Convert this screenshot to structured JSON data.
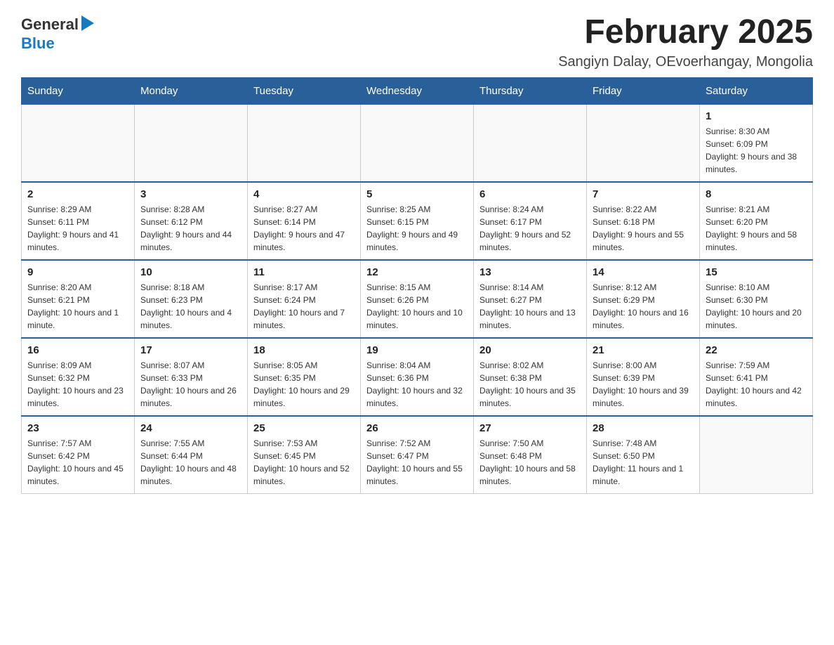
{
  "header": {
    "logo_general": "General",
    "logo_blue": "Blue",
    "month_title": "February 2025",
    "location": "Sangiyn Dalay, OEvoerhangay, Mongolia"
  },
  "days_of_week": [
    "Sunday",
    "Monday",
    "Tuesday",
    "Wednesday",
    "Thursday",
    "Friday",
    "Saturday"
  ],
  "weeks": [
    {
      "days": [
        {
          "num": "",
          "info": ""
        },
        {
          "num": "",
          "info": ""
        },
        {
          "num": "",
          "info": ""
        },
        {
          "num": "",
          "info": ""
        },
        {
          "num": "",
          "info": ""
        },
        {
          "num": "",
          "info": ""
        },
        {
          "num": "1",
          "info": "Sunrise: 8:30 AM\nSunset: 6:09 PM\nDaylight: 9 hours and 38 minutes."
        }
      ]
    },
    {
      "days": [
        {
          "num": "2",
          "info": "Sunrise: 8:29 AM\nSunset: 6:11 PM\nDaylight: 9 hours and 41 minutes."
        },
        {
          "num": "3",
          "info": "Sunrise: 8:28 AM\nSunset: 6:12 PM\nDaylight: 9 hours and 44 minutes."
        },
        {
          "num": "4",
          "info": "Sunrise: 8:27 AM\nSunset: 6:14 PM\nDaylight: 9 hours and 47 minutes."
        },
        {
          "num": "5",
          "info": "Sunrise: 8:25 AM\nSunset: 6:15 PM\nDaylight: 9 hours and 49 minutes."
        },
        {
          "num": "6",
          "info": "Sunrise: 8:24 AM\nSunset: 6:17 PM\nDaylight: 9 hours and 52 minutes."
        },
        {
          "num": "7",
          "info": "Sunrise: 8:22 AM\nSunset: 6:18 PM\nDaylight: 9 hours and 55 minutes."
        },
        {
          "num": "8",
          "info": "Sunrise: 8:21 AM\nSunset: 6:20 PM\nDaylight: 9 hours and 58 minutes."
        }
      ]
    },
    {
      "days": [
        {
          "num": "9",
          "info": "Sunrise: 8:20 AM\nSunset: 6:21 PM\nDaylight: 10 hours and 1 minute."
        },
        {
          "num": "10",
          "info": "Sunrise: 8:18 AM\nSunset: 6:23 PM\nDaylight: 10 hours and 4 minutes."
        },
        {
          "num": "11",
          "info": "Sunrise: 8:17 AM\nSunset: 6:24 PM\nDaylight: 10 hours and 7 minutes."
        },
        {
          "num": "12",
          "info": "Sunrise: 8:15 AM\nSunset: 6:26 PM\nDaylight: 10 hours and 10 minutes."
        },
        {
          "num": "13",
          "info": "Sunrise: 8:14 AM\nSunset: 6:27 PM\nDaylight: 10 hours and 13 minutes."
        },
        {
          "num": "14",
          "info": "Sunrise: 8:12 AM\nSunset: 6:29 PM\nDaylight: 10 hours and 16 minutes."
        },
        {
          "num": "15",
          "info": "Sunrise: 8:10 AM\nSunset: 6:30 PM\nDaylight: 10 hours and 20 minutes."
        }
      ]
    },
    {
      "days": [
        {
          "num": "16",
          "info": "Sunrise: 8:09 AM\nSunset: 6:32 PM\nDaylight: 10 hours and 23 minutes."
        },
        {
          "num": "17",
          "info": "Sunrise: 8:07 AM\nSunset: 6:33 PM\nDaylight: 10 hours and 26 minutes."
        },
        {
          "num": "18",
          "info": "Sunrise: 8:05 AM\nSunset: 6:35 PM\nDaylight: 10 hours and 29 minutes."
        },
        {
          "num": "19",
          "info": "Sunrise: 8:04 AM\nSunset: 6:36 PM\nDaylight: 10 hours and 32 minutes."
        },
        {
          "num": "20",
          "info": "Sunrise: 8:02 AM\nSunset: 6:38 PM\nDaylight: 10 hours and 35 minutes."
        },
        {
          "num": "21",
          "info": "Sunrise: 8:00 AM\nSunset: 6:39 PM\nDaylight: 10 hours and 39 minutes."
        },
        {
          "num": "22",
          "info": "Sunrise: 7:59 AM\nSunset: 6:41 PM\nDaylight: 10 hours and 42 minutes."
        }
      ]
    },
    {
      "days": [
        {
          "num": "23",
          "info": "Sunrise: 7:57 AM\nSunset: 6:42 PM\nDaylight: 10 hours and 45 minutes."
        },
        {
          "num": "24",
          "info": "Sunrise: 7:55 AM\nSunset: 6:44 PM\nDaylight: 10 hours and 48 minutes."
        },
        {
          "num": "25",
          "info": "Sunrise: 7:53 AM\nSunset: 6:45 PM\nDaylight: 10 hours and 52 minutes."
        },
        {
          "num": "26",
          "info": "Sunrise: 7:52 AM\nSunset: 6:47 PM\nDaylight: 10 hours and 55 minutes."
        },
        {
          "num": "27",
          "info": "Sunrise: 7:50 AM\nSunset: 6:48 PM\nDaylight: 10 hours and 58 minutes."
        },
        {
          "num": "28",
          "info": "Sunrise: 7:48 AM\nSunset: 6:50 PM\nDaylight: 11 hours and 1 minute."
        },
        {
          "num": "",
          "info": ""
        }
      ]
    }
  ]
}
